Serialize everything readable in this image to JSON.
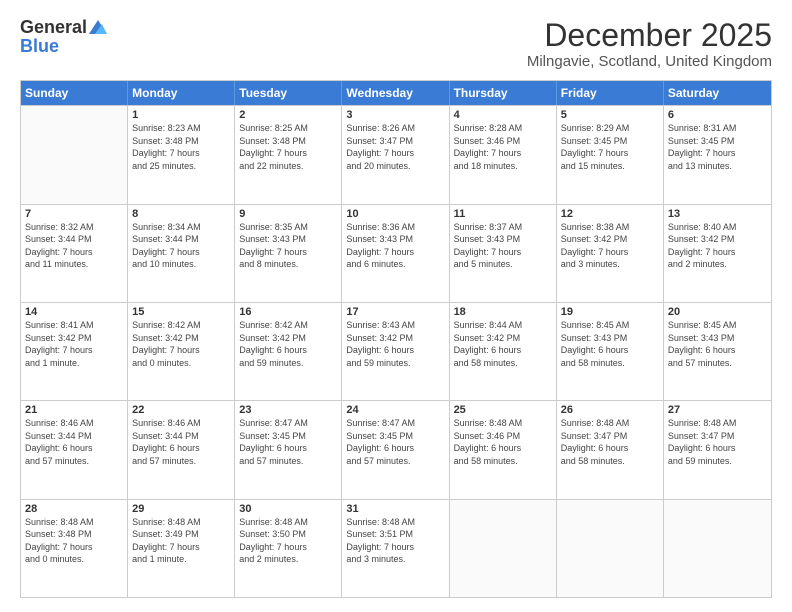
{
  "logo": {
    "general": "General",
    "blue": "Blue"
  },
  "header": {
    "title": "December 2025",
    "location": "Milngavie, Scotland, United Kingdom"
  },
  "days": [
    "Sunday",
    "Monday",
    "Tuesday",
    "Wednesday",
    "Thursday",
    "Friday",
    "Saturday"
  ],
  "weeks": [
    [
      {
        "day": "",
        "content": ""
      },
      {
        "day": "1",
        "content": "Sunrise: 8:23 AM\nSunset: 3:48 PM\nDaylight: 7 hours\nand 25 minutes."
      },
      {
        "day": "2",
        "content": "Sunrise: 8:25 AM\nSunset: 3:48 PM\nDaylight: 7 hours\nand 22 minutes."
      },
      {
        "day": "3",
        "content": "Sunrise: 8:26 AM\nSunset: 3:47 PM\nDaylight: 7 hours\nand 20 minutes."
      },
      {
        "day": "4",
        "content": "Sunrise: 8:28 AM\nSunset: 3:46 PM\nDaylight: 7 hours\nand 18 minutes."
      },
      {
        "day": "5",
        "content": "Sunrise: 8:29 AM\nSunset: 3:45 PM\nDaylight: 7 hours\nand 15 minutes."
      },
      {
        "day": "6",
        "content": "Sunrise: 8:31 AM\nSunset: 3:45 PM\nDaylight: 7 hours\nand 13 minutes."
      }
    ],
    [
      {
        "day": "7",
        "content": "Sunrise: 8:32 AM\nSunset: 3:44 PM\nDaylight: 7 hours\nand 11 minutes."
      },
      {
        "day": "8",
        "content": "Sunrise: 8:34 AM\nSunset: 3:44 PM\nDaylight: 7 hours\nand 10 minutes."
      },
      {
        "day": "9",
        "content": "Sunrise: 8:35 AM\nSunset: 3:43 PM\nDaylight: 7 hours\nand 8 minutes."
      },
      {
        "day": "10",
        "content": "Sunrise: 8:36 AM\nSunset: 3:43 PM\nDaylight: 7 hours\nand 6 minutes."
      },
      {
        "day": "11",
        "content": "Sunrise: 8:37 AM\nSunset: 3:43 PM\nDaylight: 7 hours\nand 5 minutes."
      },
      {
        "day": "12",
        "content": "Sunrise: 8:38 AM\nSunset: 3:42 PM\nDaylight: 7 hours\nand 3 minutes."
      },
      {
        "day": "13",
        "content": "Sunrise: 8:40 AM\nSunset: 3:42 PM\nDaylight: 7 hours\nand 2 minutes."
      }
    ],
    [
      {
        "day": "14",
        "content": "Sunrise: 8:41 AM\nSunset: 3:42 PM\nDaylight: 7 hours\nand 1 minute."
      },
      {
        "day": "15",
        "content": "Sunrise: 8:42 AM\nSunset: 3:42 PM\nDaylight: 7 hours\nand 0 minutes."
      },
      {
        "day": "16",
        "content": "Sunrise: 8:42 AM\nSunset: 3:42 PM\nDaylight: 6 hours\nand 59 minutes."
      },
      {
        "day": "17",
        "content": "Sunrise: 8:43 AM\nSunset: 3:42 PM\nDaylight: 6 hours\nand 59 minutes."
      },
      {
        "day": "18",
        "content": "Sunrise: 8:44 AM\nSunset: 3:42 PM\nDaylight: 6 hours\nand 58 minutes."
      },
      {
        "day": "19",
        "content": "Sunrise: 8:45 AM\nSunset: 3:43 PM\nDaylight: 6 hours\nand 58 minutes."
      },
      {
        "day": "20",
        "content": "Sunrise: 8:45 AM\nSunset: 3:43 PM\nDaylight: 6 hours\nand 57 minutes."
      }
    ],
    [
      {
        "day": "21",
        "content": "Sunrise: 8:46 AM\nSunset: 3:44 PM\nDaylight: 6 hours\nand 57 minutes."
      },
      {
        "day": "22",
        "content": "Sunrise: 8:46 AM\nSunset: 3:44 PM\nDaylight: 6 hours\nand 57 minutes."
      },
      {
        "day": "23",
        "content": "Sunrise: 8:47 AM\nSunset: 3:45 PM\nDaylight: 6 hours\nand 57 minutes."
      },
      {
        "day": "24",
        "content": "Sunrise: 8:47 AM\nSunset: 3:45 PM\nDaylight: 6 hours\nand 57 minutes."
      },
      {
        "day": "25",
        "content": "Sunrise: 8:48 AM\nSunset: 3:46 PM\nDaylight: 6 hours\nand 58 minutes."
      },
      {
        "day": "26",
        "content": "Sunrise: 8:48 AM\nSunset: 3:47 PM\nDaylight: 6 hours\nand 58 minutes."
      },
      {
        "day": "27",
        "content": "Sunrise: 8:48 AM\nSunset: 3:47 PM\nDaylight: 6 hours\nand 59 minutes."
      }
    ],
    [
      {
        "day": "28",
        "content": "Sunrise: 8:48 AM\nSunset: 3:48 PM\nDaylight: 7 hours\nand 0 minutes."
      },
      {
        "day": "29",
        "content": "Sunrise: 8:48 AM\nSunset: 3:49 PM\nDaylight: 7 hours\nand 1 minute."
      },
      {
        "day": "30",
        "content": "Sunrise: 8:48 AM\nSunset: 3:50 PM\nDaylight: 7 hours\nand 2 minutes."
      },
      {
        "day": "31",
        "content": "Sunrise: 8:48 AM\nSunset: 3:51 PM\nDaylight: 7 hours\nand 3 minutes."
      },
      {
        "day": "",
        "content": ""
      },
      {
        "day": "",
        "content": ""
      },
      {
        "day": "",
        "content": ""
      }
    ]
  ]
}
